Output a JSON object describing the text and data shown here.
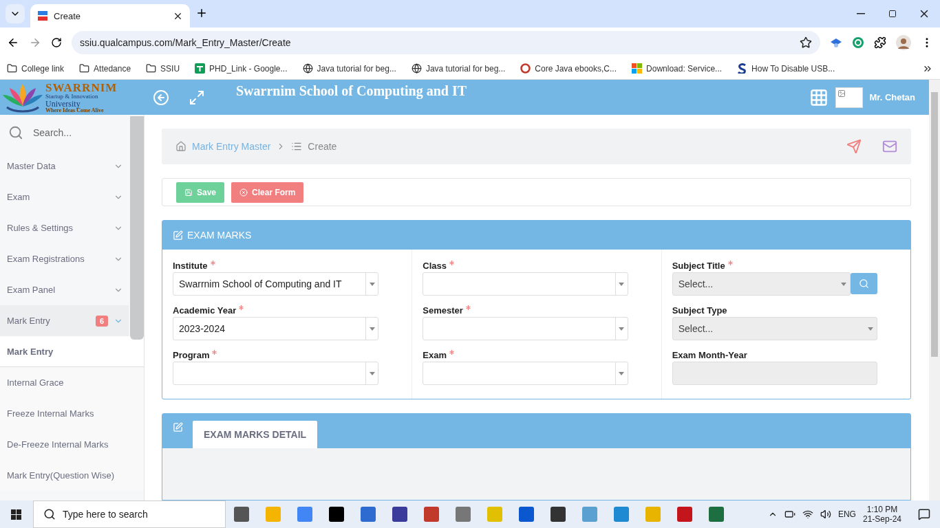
{
  "browser": {
    "tabs": [
      {
        "title": "Create",
        "selected": true
      }
    ],
    "url": "ssiu.qualcampus.com/Mark_Entry_Master/Create",
    "bookmarks": [
      {
        "label": "College link",
        "kind": "folder"
      },
      {
        "label": "Attedance",
        "kind": "folder"
      },
      {
        "label": "SSIU",
        "kind": "folder"
      },
      {
        "label": "PHD_Link - Google...",
        "kind": "sheet"
      },
      {
        "label": "Java tutorial for beg...",
        "kind": "globe"
      },
      {
        "label": "Java tutorial for beg...",
        "kind": "globe"
      },
      {
        "label": "Core Java ebooks,C...",
        "kind": "badge"
      },
      {
        "label": "Download: Service...",
        "kind": "tiles"
      },
      {
        "label": "How To Disable USB...",
        "kind": "letter"
      }
    ]
  },
  "header": {
    "logo": [
      "SWARRNIM",
      "Startup & Innovation",
      "University",
      "Where Ideas Come Alive"
    ],
    "title": "Swarrnim School of Computing and IT",
    "user": "Mr. Chetan"
  },
  "sidebar": {
    "search_placeholder": "Search...",
    "items": [
      {
        "label": "Master Data",
        "expanded": false
      },
      {
        "label": "Exam",
        "expanded": false
      },
      {
        "label": "Rules & Settings",
        "expanded": false
      },
      {
        "label": "Exam Registrations",
        "expanded": false
      },
      {
        "label": "Exam Panel",
        "expanded": false
      },
      {
        "label": "Mark Entry",
        "expanded": true,
        "badge": "6",
        "children": [
          {
            "label": "Mark Entry",
            "selected": true
          },
          {
            "label": "Internal Grace",
            "selected": false
          },
          {
            "label": "Freeze Internal Marks",
            "selected": false
          },
          {
            "label": "De-Freeze Internal Marks",
            "selected": false
          },
          {
            "label": "Mark Entry(Question Wise)",
            "selected": false
          }
        ]
      }
    ]
  },
  "breadcrumb": [
    "Mark Entry Master",
    "Create"
  ],
  "actions": [
    {
      "label": "Save",
      "kind": "save"
    },
    {
      "label": "Clear Form",
      "kind": "clear"
    }
  ],
  "exam_marks": {
    "title": "EXAM MARKS",
    "columns": [
      [
        {
          "label": "Institute",
          "required": true,
          "kind": "select",
          "value": "Swarrnim School of Computing and IT"
        },
        {
          "label": "Academic Year",
          "required": true,
          "kind": "select",
          "value": "2023-2024"
        },
        {
          "label": "Program",
          "required": true,
          "kind": "select"
        }
      ],
      [
        {
          "label": "Class",
          "required": true,
          "kind": "select"
        },
        {
          "label": "Semester",
          "required": true,
          "kind": "select"
        },
        {
          "label": "Exam",
          "required": true,
          "kind": "select"
        }
      ],
      [
        {
          "label": "Subject Title",
          "required": true,
          "kind": "search-select",
          "placeholder": "Select..."
        },
        {
          "label": "Subject Type",
          "required": false,
          "kind": "gray-select",
          "placeholder": "Select..."
        },
        {
          "label": "Exam Month-Year",
          "required": false,
          "kind": "disabled-input"
        }
      ]
    ]
  },
  "detail": {
    "tabs": [
      {
        "label": "EXAM MARKS DETAIL",
        "selected": true
      }
    ]
  },
  "taskbar": {
    "search_placeholder": "Type here to search",
    "language": "ENG",
    "time": "1:10 PM",
    "date": "21-Sep-24"
  }
}
